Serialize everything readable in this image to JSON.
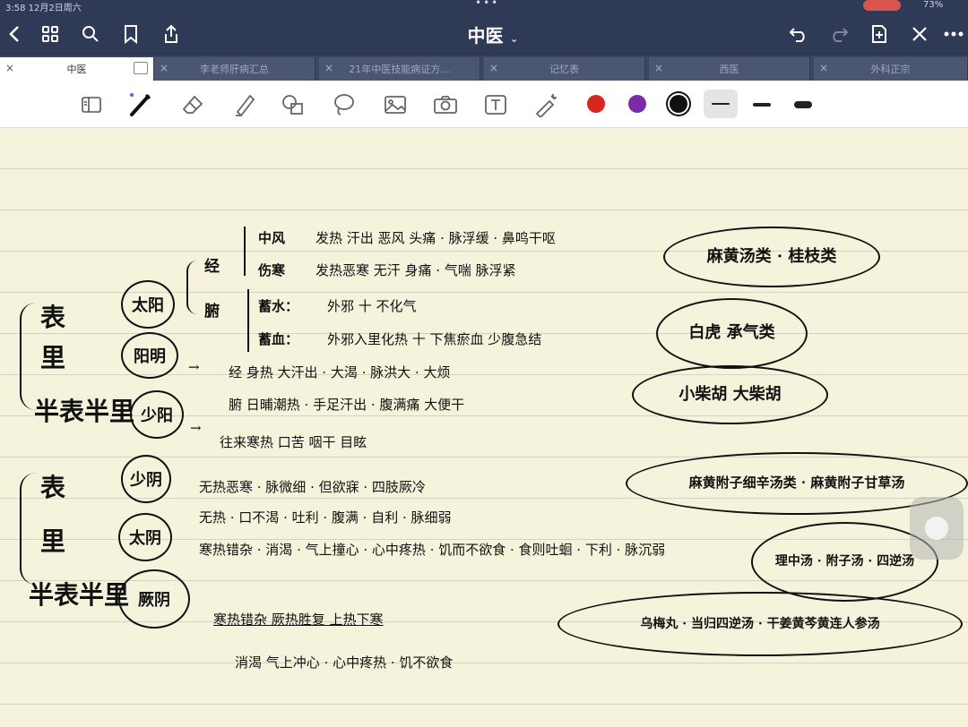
{
  "status": {
    "time": "3:58  12月2日周六",
    "battery": "73%"
  },
  "titlebar": {
    "title": "中医",
    "caret": "⌄"
  },
  "tabs": [
    {
      "label": "中医",
      "active": true
    },
    {
      "label": "李老师肝病汇总"
    },
    {
      "label": "21年中医技能病证方..."
    },
    {
      "label": "记忆表"
    },
    {
      "label": "西医"
    },
    {
      "label": "外科正宗"
    }
  ],
  "colors": {
    "red": "#d7261e",
    "purple": "#7b2aa8",
    "black": "#111111",
    "accent": "#2f3a56"
  },
  "notes": {
    "left_labels": [
      "表",
      "里",
      "半表半里",
      "表",
      "里",
      "半表半里"
    ],
    "circles": [
      "太阳",
      "阳明",
      "少阳",
      "少阴",
      "太阴",
      "厥阴"
    ],
    "taiyang": {
      "jing": "经",
      "fu": "腑",
      "line1_tag": "中风",
      "line1": "发热 汗出 恶风 头痛 · 脉浮缓 · 鼻鸣干呕",
      "line2_tag": "伤寒",
      "line2": "发热恶寒 无汗 身痛 · 气喘 脉浮紧",
      "line3_tag": "蓄水：",
      "line3": "外邪 十 不化气",
      "line4_tag": "蓄血：",
      "line4": "外邪入里化热 十 下焦瘀血 少腹急结"
    },
    "yangming": {
      "line1": "经  身热 大汗出 · 大渴 · 脉洪大 · 大烦",
      "line2": "腑  日晡潮热 · 手足汗出 · 腹满痛 大便干"
    },
    "shaoyang": {
      "line1": "往来寒热 口苦 咽干 目眩"
    },
    "shaoyin": {
      "line1": "无热恶寒 · 脉微细 · 但欲寐 · 四肢厥冷"
    },
    "taiyin": {
      "line1": "无热 · 口不渴 · 吐利 · 腹满 · 自利 · 脉细弱"
    },
    "jueyin_lines": [
      "寒热错杂 · 消渴 · 气上撞心 · 心中疼热 · 饥而不欲食 · 食则吐蛔 · 下利 · 脉沉弱",
      "寒热错杂  厥热胜复  上热下寒",
      "消渴 气上冲心 · 心中疼热 · 饥不欲食"
    ],
    "ovals": [
      "麻黄汤类 · 桂枝类",
      "白虎 承气类",
      "小柴胡 大柴胡",
      "麻黄附子细辛汤类 · 麻黄附子甘草汤",
      "理中汤 · 附子汤 · 四逆汤",
      "乌梅丸 · 当归四逆汤 · 干姜黄芩黄连人参汤"
    ]
  }
}
